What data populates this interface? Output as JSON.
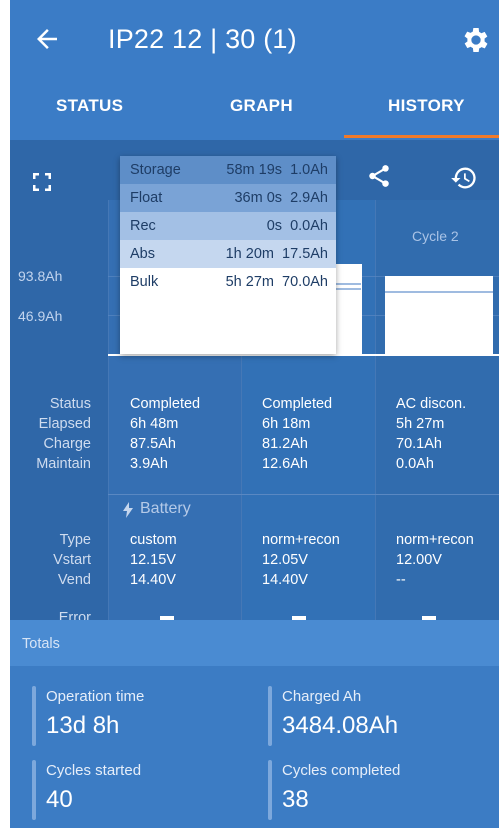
{
  "header": {
    "title": "IP22 12 | 30 (1)"
  },
  "tabs": [
    {
      "label": "STATUS"
    },
    {
      "label": "GRAPH"
    },
    {
      "label": "HISTORY"
    }
  ],
  "colors": {
    "accent": "#f07a2a",
    "primary": "#3b7cc6",
    "content_bg": "#2f67a8"
  },
  "icons": {
    "back": "arrow-left-icon",
    "settings": "gear-icon",
    "expand": "fullscreen-icon",
    "share": "share-icon",
    "restore": "history-restore-icon",
    "battery": "lightning-bolt-icon"
  },
  "chart_data": {
    "type": "bar",
    "categories": [
      "",
      "",
      "Cycle 2"
    ],
    "y_ticks": [
      "93.8Ah",
      "46.9Ah"
    ],
    "stages": [
      {
        "name": "Storage",
        "duration": "58m 19s",
        "charge": "1.0Ah",
        "color": "#5e8ec8"
      },
      {
        "name": "Float",
        "duration": "36m 0s",
        "charge": "2.9Ah",
        "color": "#7aa3d6"
      },
      {
        "name": "Rec",
        "duration": "0s",
        "charge": "0.0Ah",
        "color": "#a3c0e5"
      },
      {
        "name": "Abs",
        "duration": "1h 20m",
        "charge": "17.5Ah",
        "color": "#c5d7ef"
      },
      {
        "name": "Bulk",
        "duration": "5h 27m",
        "charge": "70.0Ah",
        "color": "#ffffff"
      }
    ],
    "series": [
      {
        "values": [
          87.5,
          81.2,
          70.1
        ]
      }
    ],
    "ylim": [
      0,
      140.7
    ]
  },
  "details": {
    "labels": {
      "status": "Status",
      "elapsed": "Elapsed",
      "charge": "Charge",
      "maintain": "Maintain",
      "type": "Type",
      "vstart": "Vstart",
      "vend": "Vend",
      "error": "Error"
    },
    "battery_label": "Battery",
    "columns": [
      {
        "status": "Completed",
        "elapsed": "6h 48m",
        "charge": "87.5Ah",
        "maintain": "3.9Ah",
        "type": "custom",
        "vstart": "12.15V",
        "vend": "14.40V"
      },
      {
        "status": "Completed",
        "elapsed": "6h 18m",
        "charge": "81.2Ah",
        "maintain": "12.6Ah",
        "type": "norm+recon",
        "vstart": "12.05V",
        "vend": "14.40V"
      },
      {
        "status": "AC discon.",
        "elapsed": "5h 27m",
        "charge": "70.1Ah",
        "maintain": "0.0Ah",
        "type": "norm+recon",
        "vstart": "12.00V",
        "vend": "--"
      }
    ]
  },
  "totals": {
    "title": "Totals",
    "operation_time": {
      "label": "Operation time",
      "value": "13d 8h"
    },
    "charged_ah": {
      "label": "Charged Ah",
      "value": "3484.08Ah"
    },
    "cycles_started": {
      "label": "Cycles started",
      "value": "40"
    },
    "cycles_completed": {
      "label": "Cycles completed",
      "value": "38"
    }
  }
}
